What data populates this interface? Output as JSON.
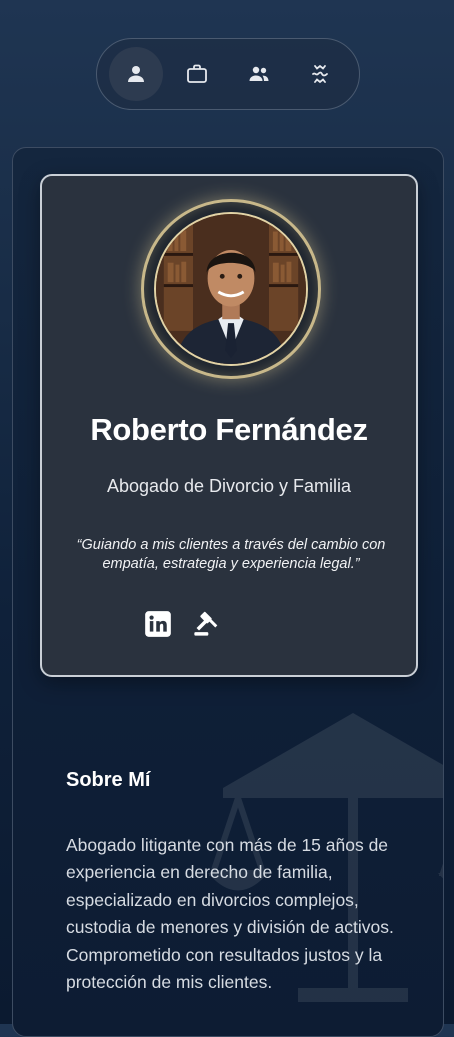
{
  "nav": {
    "items": [
      {
        "icon": "user-icon",
        "active": true
      },
      {
        "icon": "briefcase-icon",
        "active": false
      },
      {
        "icon": "users-icon",
        "active": false
      },
      {
        "icon": "wave-icon",
        "active": false
      }
    ]
  },
  "profile": {
    "name": "Roberto Fernández",
    "role": "Abogado de Divorcio y Familia",
    "quote": "“Guiando a mis clientes a través del cambio con empatía, estrategia y experiencia legal.”",
    "socials": [
      "linkedin-icon",
      "gavel-icon"
    ]
  },
  "about": {
    "title": "Sobre Mí",
    "text": "Abogado litigante con más de 15 años de experiencia en derecho de familia, especializado en divorcios complejos, custodia de menores y división de activos. Comprometido con resultados justos y la protección de mis clientes."
  },
  "colors": {
    "accent_gold": "#c8b88a",
    "background": "#14263e",
    "card": "#2a323e"
  }
}
